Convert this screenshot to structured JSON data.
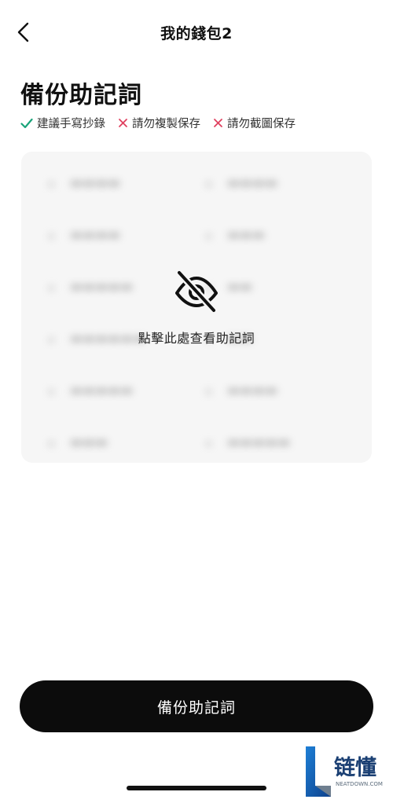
{
  "header": {
    "title": "我的錢包2"
  },
  "page": {
    "title": "備份助記詞"
  },
  "tips": [
    {
      "label": "建議手寫抄錄",
      "icon": "check-icon",
      "color": "#1aa47a"
    },
    {
      "label": "請勿複製保存",
      "icon": "cross-icon",
      "color": "#e0405f"
    },
    {
      "label": "請勿截圖保存",
      "icon": "cross-icon",
      "color": "#e0405f"
    }
  ],
  "mnemonic": {
    "hidden": true,
    "reveal_label": "點擊此處查看助記詞",
    "icon": "eye-off-icon"
  },
  "footer": {
    "button_label": "備份助記詞"
  },
  "watermark": {
    "text": "链懂",
    "subtext": "NEATDOWN.COM"
  }
}
